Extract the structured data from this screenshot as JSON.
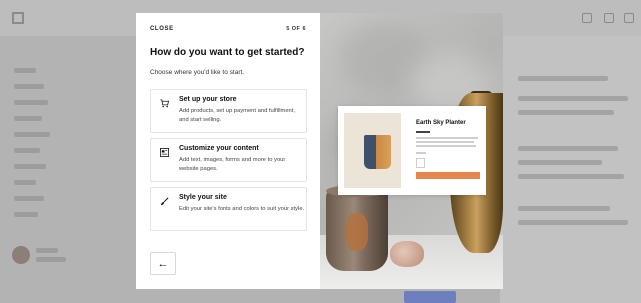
{
  "dialog": {
    "close_label": "CLOSE",
    "step_label": "5 OF 6",
    "title": "How do you want to get started?",
    "subtitle": "Choose where you'd like to start."
  },
  "options": [
    {
      "icon": "cart-icon",
      "title": "Set up your store",
      "description": "Add products, set up payment and fulfillment, and start selling."
    },
    {
      "icon": "content-icon",
      "title": "Customize your content",
      "description": "Add text, images, forms and more to your website pages."
    },
    {
      "icon": "brush-icon",
      "title": "Style your site",
      "description": "Edit your site's fonts and colors to suit your style."
    }
  ],
  "back_button": {
    "icon": "arrow-left-icon",
    "label": "←"
  },
  "preview": {
    "product_title": "Earth Sky Planter"
  },
  "colors": {
    "accent_button": "#e3874f",
    "overlay": "#b3b3b3",
    "modal_bg": "#ffffff"
  }
}
